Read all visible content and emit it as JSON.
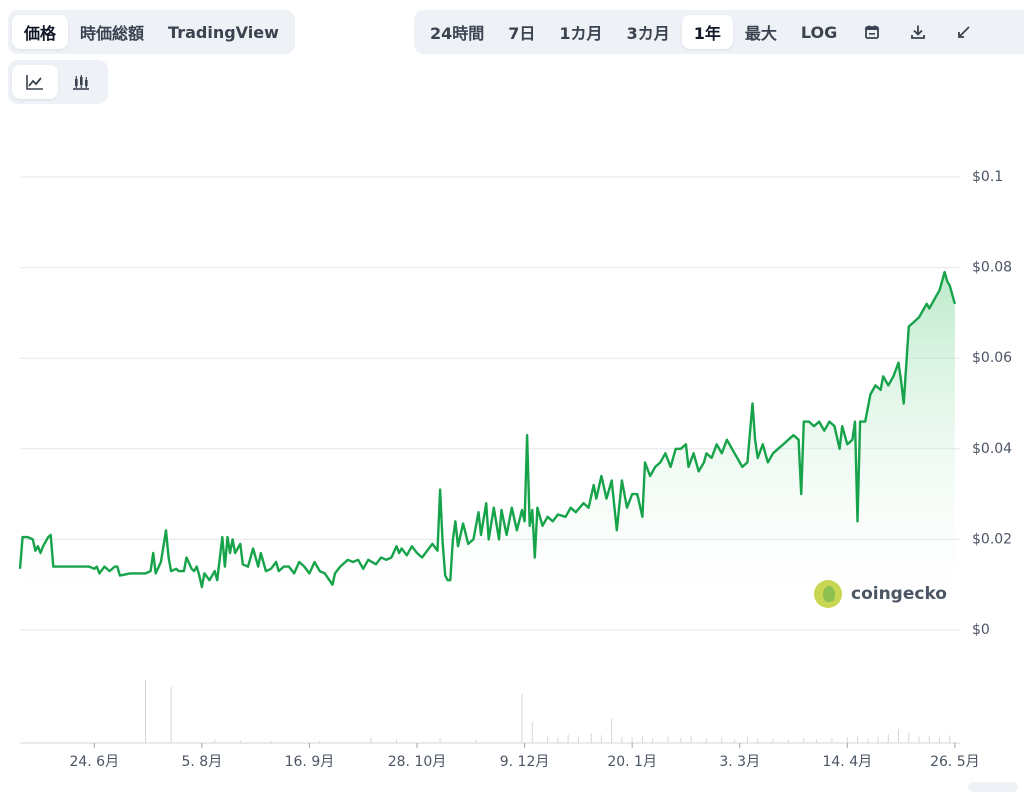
{
  "tabs": {
    "chart_type": [
      {
        "label": "価格",
        "active": true
      },
      {
        "label": "時価総額",
        "active": false
      },
      {
        "label": "TradingView",
        "active": false
      }
    ],
    "range": [
      {
        "label": "24時間",
        "active": false
      },
      {
        "label": "7日",
        "active": false
      },
      {
        "label": "1カ月",
        "active": false
      },
      {
        "label": "3カ月",
        "active": false
      },
      {
        "label": "1年",
        "active": true
      },
      {
        "label": "最大",
        "active": false
      },
      {
        "label": "LOG",
        "active": false
      }
    ],
    "icons": [
      "calendar-icon",
      "download-icon",
      "expand-icon"
    ],
    "view": [
      {
        "icon": "line-chart-icon",
        "active": true
      },
      {
        "icon": "candlestick-chart-icon",
        "active": false
      }
    ]
  },
  "watermark": {
    "text": "coingecko"
  },
  "colors": {
    "line": "#16a34a",
    "fill_top": "#86d9a0",
    "grid": "#e5e7eb",
    "volume": "#d1d5db"
  },
  "chart_data": {
    "type": "area",
    "title": "",
    "xlabel": "",
    "ylabel": "",
    "ylim": [
      0,
      0.1
    ],
    "yticks": [
      0,
      0.02,
      0.04,
      0.06,
      0.08,
      0.1
    ],
    "ytick_labels": [
      "$0",
      "$0.02",
      "$0.04",
      "$0.06",
      "$0.08",
      "$0.1"
    ],
    "xlim": [
      "2024-05-26",
      "2025-05-28"
    ],
    "xticks": [
      {
        "date": "2024-06-24",
        "label": "24. 6月"
      },
      {
        "date": "2024-08-05",
        "label": "5. 8月"
      },
      {
        "date": "2024-09-16",
        "label": "16. 9月"
      },
      {
        "date": "2024-10-28",
        "label": "28. 10月"
      },
      {
        "date": "2024-12-09",
        "label": "9. 12月"
      },
      {
        "date": "2025-01-20",
        "label": "20. 1月"
      },
      {
        "date": "2025-03-03",
        "label": "3. 3月"
      },
      {
        "date": "2025-04-14",
        "label": "14. 4月"
      },
      {
        "date": "2025-05-26",
        "label": "26. 5月"
      }
    ],
    "grid": true,
    "series": [
      {
        "points": [
          [
            "2024-05-26",
            0.0135
          ],
          [
            "2024-05-27",
            0.0205
          ],
          [
            "2024-05-29",
            0.0205
          ],
          [
            "2024-05-31",
            0.02
          ],
          [
            "2024-06-01",
            0.0175
          ],
          [
            "2024-06-02",
            0.0185
          ],
          [
            "2024-06-03",
            0.017
          ],
          [
            "2024-06-04",
            0.0185
          ],
          [
            "2024-06-06",
            0.0205
          ],
          [
            "2024-06-07",
            0.021
          ],
          [
            "2024-06-08",
            0.014
          ],
          [
            "2024-06-12",
            0.014
          ],
          [
            "2024-06-18",
            0.014
          ],
          [
            "2024-06-22",
            0.014
          ],
          [
            "2024-06-24",
            0.0135
          ],
          [
            "2024-06-25",
            0.014
          ],
          [
            "2024-06-26",
            0.0125
          ],
          [
            "2024-06-28",
            0.014
          ],
          [
            "2024-06-30",
            0.013
          ],
          [
            "2024-07-02",
            0.014
          ],
          [
            "2024-07-03",
            0.014
          ],
          [
            "2024-07-04",
            0.012
          ],
          [
            "2024-07-08",
            0.0125
          ],
          [
            "2024-07-11",
            0.0125
          ],
          [
            "2024-07-14",
            0.0125
          ],
          [
            "2024-07-16",
            0.013
          ],
          [
            "2024-07-17",
            0.017
          ],
          [
            "2024-07-18",
            0.0125
          ],
          [
            "2024-07-20",
            0.015
          ],
          [
            "2024-07-22",
            0.022
          ],
          [
            "2024-07-23",
            0.016
          ],
          [
            "2024-07-24",
            0.013
          ],
          [
            "2024-07-26",
            0.0135
          ],
          [
            "2024-07-27",
            0.013
          ],
          [
            "2024-07-29",
            0.013
          ],
          [
            "2024-07-30",
            0.016
          ],
          [
            "2024-08-01",
            0.0135
          ],
          [
            "2024-08-02",
            0.013
          ],
          [
            "2024-08-03",
            0.014
          ],
          [
            "2024-08-04",
            0.012
          ],
          [
            "2024-08-05",
            0.0095
          ],
          [
            "2024-08-06",
            0.0125
          ],
          [
            "2024-08-08",
            0.011
          ],
          [
            "2024-08-10",
            0.013
          ],
          [
            "2024-08-11",
            0.011
          ],
          [
            "2024-08-13",
            0.0205
          ],
          [
            "2024-08-14",
            0.014
          ],
          [
            "2024-08-15",
            0.0205
          ],
          [
            "2024-08-16",
            0.017
          ],
          [
            "2024-08-17",
            0.02
          ],
          [
            "2024-08-18",
            0.017
          ],
          [
            "2024-08-20",
            0.019
          ],
          [
            "2024-08-21",
            0.0145
          ],
          [
            "2024-08-23",
            0.014
          ],
          [
            "2024-08-25",
            0.018
          ],
          [
            "2024-08-27",
            0.014
          ],
          [
            "2024-08-28",
            0.017
          ],
          [
            "2024-08-30",
            0.013
          ],
          [
            "2024-09-01",
            0.0135
          ],
          [
            "2024-09-03",
            0.015
          ],
          [
            "2024-09-04",
            0.013
          ],
          [
            "2024-09-06",
            0.014
          ],
          [
            "2024-09-08",
            0.014
          ],
          [
            "2024-09-10",
            0.0125
          ],
          [
            "2024-09-12",
            0.015
          ],
          [
            "2024-09-14",
            0.014
          ],
          [
            "2024-09-16",
            0.0125
          ],
          [
            "2024-09-18",
            0.015
          ],
          [
            "2024-09-20",
            0.013
          ],
          [
            "2024-09-22",
            0.0125
          ],
          [
            "2024-09-25",
            0.01
          ],
          [
            "2024-09-26",
            0.0125
          ],
          [
            "2024-09-28",
            0.014
          ],
          [
            "2024-10-01",
            0.0155
          ],
          [
            "2024-10-03",
            0.015
          ],
          [
            "2024-10-05",
            0.0155
          ],
          [
            "2024-10-07",
            0.0135
          ],
          [
            "2024-10-09",
            0.0155
          ],
          [
            "2024-10-12",
            0.0145
          ],
          [
            "2024-10-14",
            0.016
          ],
          [
            "2024-10-16",
            0.0155
          ],
          [
            "2024-10-18",
            0.016
          ],
          [
            "2024-10-20",
            0.0185
          ],
          [
            "2024-10-21",
            0.017
          ],
          [
            "2024-10-22",
            0.018
          ],
          [
            "2024-10-24",
            0.0165
          ],
          [
            "2024-10-26",
            0.0185
          ],
          [
            "2024-10-28",
            0.017
          ],
          [
            "2024-10-30",
            0.016
          ],
          [
            "2024-11-01",
            0.0175
          ],
          [
            "2024-11-03",
            0.019
          ],
          [
            "2024-11-05",
            0.0175
          ],
          [
            "2024-11-06",
            0.031
          ],
          [
            "2024-11-07",
            0.0195
          ],
          [
            "2024-11-08",
            0.012
          ],
          [
            "2024-11-09",
            0.011
          ],
          [
            "2024-11-10",
            0.011
          ],
          [
            "2024-11-11",
            0.02
          ],
          [
            "2024-11-12",
            0.024
          ],
          [
            "2024-11-13",
            0.0185
          ],
          [
            "2024-11-15",
            0.0235
          ],
          [
            "2024-11-17",
            0.019
          ],
          [
            "2024-11-19",
            0.02
          ],
          [
            "2024-11-21",
            0.026
          ],
          [
            "2024-11-22",
            0.021
          ],
          [
            "2024-11-24",
            0.028
          ],
          [
            "2024-11-25",
            0.02
          ],
          [
            "2024-11-27",
            0.027
          ],
          [
            "2024-11-29",
            0.02
          ],
          [
            "2024-11-30",
            0.0265
          ],
          [
            "2024-12-02",
            0.021
          ],
          [
            "2024-12-04",
            0.027
          ],
          [
            "2024-12-06",
            0.022
          ],
          [
            "2024-12-08",
            0.0265
          ],
          [
            "2024-12-09",
            0.024
          ],
          [
            "2024-12-10",
            0.043
          ],
          [
            "2024-12-11",
            0.023
          ],
          [
            "2024-12-12",
            0.0265
          ],
          [
            "2024-12-13",
            0.016
          ],
          [
            "2024-12-14",
            0.027
          ],
          [
            "2024-12-16",
            0.023
          ],
          [
            "2024-12-18",
            0.025
          ],
          [
            "2024-12-20",
            0.024
          ],
          [
            "2024-12-22",
            0.0255
          ],
          [
            "2024-12-25",
            0.025
          ],
          [
            "2024-12-27",
            0.027
          ],
          [
            "2024-12-29",
            0.026
          ],
          [
            "2025-01-01",
            0.028
          ],
          [
            "2025-01-03",
            0.027
          ],
          [
            "2025-01-05",
            0.032
          ],
          [
            "2025-01-06",
            0.029
          ],
          [
            "2025-01-08",
            0.034
          ],
          [
            "2025-01-10",
            0.029
          ],
          [
            "2025-01-12",
            0.033
          ],
          [
            "2025-01-14",
            0.022
          ],
          [
            "2025-01-16",
            0.033
          ],
          [
            "2025-01-18",
            0.027
          ],
          [
            "2025-01-20",
            0.03
          ],
          [
            "2025-01-22",
            0.03
          ],
          [
            "2025-01-24",
            0.025
          ],
          [
            "2025-01-25",
            0.037
          ],
          [
            "2025-01-27",
            0.034
          ],
          [
            "2025-01-29",
            0.036
          ],
          [
            "2025-01-31",
            0.037
          ],
          [
            "2025-02-02",
            0.039
          ],
          [
            "2025-02-04",
            0.036
          ],
          [
            "2025-02-06",
            0.04
          ],
          [
            "2025-02-08",
            0.04
          ],
          [
            "2025-02-10",
            0.041
          ],
          [
            "2025-02-11",
            0.036
          ],
          [
            "2025-02-13",
            0.039
          ],
          [
            "2025-02-15",
            0.035
          ],
          [
            "2025-02-17",
            0.037
          ],
          [
            "2025-02-18",
            0.039
          ],
          [
            "2025-02-20",
            0.038
          ],
          [
            "2025-02-22",
            0.041
          ],
          [
            "2025-02-24",
            0.039
          ],
          [
            "2025-02-26",
            0.042
          ],
          [
            "2025-02-28",
            0.04
          ],
          [
            "2025-03-02",
            0.038
          ],
          [
            "2025-03-04",
            0.036
          ],
          [
            "2025-03-06",
            0.037
          ],
          [
            "2025-03-08",
            0.05
          ],
          [
            "2025-03-09",
            0.042
          ],
          [
            "2025-03-10",
            0.038
          ],
          [
            "2025-03-12",
            0.041
          ],
          [
            "2025-03-14",
            0.037
          ],
          [
            "2025-03-16",
            0.039
          ],
          [
            "2025-03-18",
            0.04
          ],
          [
            "2025-03-20",
            0.041
          ],
          [
            "2025-03-22",
            0.042
          ],
          [
            "2025-03-24",
            0.043
          ],
          [
            "2025-03-26",
            0.042
          ],
          [
            "2025-03-27",
            0.03
          ],
          [
            "2025-03-28",
            0.046
          ],
          [
            "2025-03-30",
            0.046
          ],
          [
            "2025-04-01",
            0.045
          ],
          [
            "2025-04-03",
            0.046
          ],
          [
            "2025-04-05",
            0.044
          ],
          [
            "2025-04-07",
            0.046
          ],
          [
            "2025-04-09",
            0.045
          ],
          [
            "2025-04-11",
            0.04
          ],
          [
            "2025-04-12",
            0.045
          ],
          [
            "2025-04-14",
            0.041
          ],
          [
            "2025-04-16",
            0.042
          ],
          [
            "2025-04-17",
            0.046
          ],
          [
            "2025-04-18",
            0.024
          ],
          [
            "2025-04-19",
            0.046
          ],
          [
            "2025-04-21",
            0.046
          ],
          [
            "2025-04-23",
            0.052
          ],
          [
            "2025-04-25",
            0.054
          ],
          [
            "2025-04-27",
            0.053
          ],
          [
            "2025-04-28",
            0.056
          ],
          [
            "2025-04-30",
            0.054
          ],
          [
            "2025-05-02",
            0.056
          ],
          [
            "2025-05-04",
            0.059
          ],
          [
            "2025-05-05",
            0.055
          ],
          [
            "2025-05-06",
            0.05
          ],
          [
            "2025-05-08",
            0.067
          ],
          [
            "2025-05-10",
            0.068
          ],
          [
            "2025-05-12",
            0.069
          ],
          [
            "2025-05-14",
            0.071
          ],
          [
            "2025-05-15",
            0.072
          ],
          [
            "2025-05-16",
            0.071
          ],
          [
            "2025-05-18",
            0.073
          ],
          [
            "2025-05-19",
            0.074
          ],
          [
            "2025-05-20",
            0.075
          ],
          [
            "2025-05-21",
            0.077
          ],
          [
            "2025-05-22",
            0.079
          ],
          [
            "2025-05-23",
            0.077
          ],
          [
            "2025-05-24",
            0.076
          ],
          [
            "2025-05-25",
            0.074
          ],
          [
            "2025-05-26",
            0.072
          ]
        ]
      }
    ],
    "volume": [
      [
        "2024-07-14",
        0.9
      ],
      [
        "2024-07-24",
        0.8
      ],
      [
        "2024-08-10",
        0.05
      ],
      [
        "2024-08-20",
        0.04
      ],
      [
        "2024-09-01",
        0.03
      ],
      [
        "2024-09-20",
        0.03
      ],
      [
        "2024-10-10",
        0.08
      ],
      [
        "2024-10-20",
        0.05
      ],
      [
        "2024-11-06",
        0.06
      ],
      [
        "2024-11-20",
        0.04
      ],
      [
        "2024-12-08",
        0.7
      ],
      [
        "2024-12-12",
        0.3
      ],
      [
        "2024-12-18",
        0.1
      ],
      [
        "2024-12-22",
        0.08
      ],
      [
        "2024-12-26",
        0.12
      ],
      [
        "2024-12-30",
        0.09
      ],
      [
        "2025-01-04",
        0.14
      ],
      [
        "2025-01-08",
        0.11
      ],
      [
        "2025-01-12",
        0.35
      ],
      [
        "2025-01-16",
        0.09
      ],
      [
        "2025-01-20",
        0.08
      ],
      [
        "2025-01-24",
        0.1
      ],
      [
        "2025-01-28",
        0.06
      ],
      [
        "2025-02-03",
        0.09
      ],
      [
        "2025-02-08",
        0.07
      ],
      [
        "2025-02-12",
        0.1
      ],
      [
        "2025-02-18",
        0.06
      ],
      [
        "2025-02-24",
        0.08
      ],
      [
        "2025-03-01",
        0.05
      ],
      [
        "2025-03-06",
        0.09
      ],
      [
        "2025-03-10",
        0.06
      ],
      [
        "2025-03-16",
        0.05
      ],
      [
        "2025-03-22",
        0.04
      ],
      [
        "2025-03-28",
        0.07
      ],
      [
        "2025-04-02",
        0.05
      ],
      [
        "2025-04-08",
        0.06
      ],
      [
        "2025-04-14",
        0.08
      ],
      [
        "2025-04-18",
        0.1
      ],
      [
        "2025-04-22",
        0.06
      ],
      [
        "2025-04-26",
        0.09
      ],
      [
        "2025-04-30",
        0.12
      ],
      [
        "2025-05-04",
        0.2
      ],
      [
        "2025-05-08",
        0.15
      ],
      [
        "2025-05-12",
        0.09
      ],
      [
        "2025-05-16",
        0.1
      ],
      [
        "2025-05-20",
        0.08
      ],
      [
        "2025-05-24",
        0.11
      ]
    ]
  }
}
